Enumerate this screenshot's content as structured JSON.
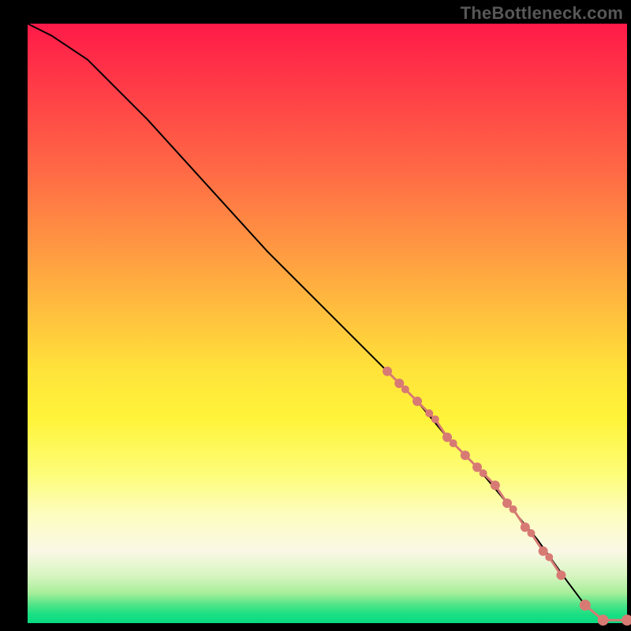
{
  "watermark": "TheBottleneck.com",
  "chart_data": {
    "type": "line",
    "title": "",
    "xlabel": "",
    "ylabel": "",
    "xlim": [
      0,
      100
    ],
    "ylim": [
      0,
      100
    ],
    "grid": false,
    "series": [
      {
        "name": "curve",
        "x": [
          0,
          4,
          10,
          20,
          30,
          40,
          50,
          60,
          65,
          70,
          75,
          80,
          85,
          90,
          93,
          96,
          100
        ],
        "y": [
          100,
          98,
          94,
          84,
          73,
          62,
          52,
          42,
          37,
          31,
          26,
          20,
          14,
          7,
          3,
          0.5,
          0.5
        ]
      }
    ],
    "markers": {
      "name": "beads",
      "x": [
        60,
        62,
        63,
        65,
        67,
        68,
        70,
        71,
        73,
        75,
        76,
        78,
        80,
        81,
        83,
        84,
        86,
        87,
        89,
        93,
        96,
        100
      ],
      "y": [
        42,
        40,
        39,
        37,
        35,
        34,
        31,
        30,
        28,
        26,
        25,
        23,
        20,
        19,
        16,
        15,
        12,
        11,
        8,
        3,
        0.5,
        0.5
      ],
      "radius": [
        6,
        6,
        5,
        6,
        5,
        5,
        6,
        5,
        6,
        6,
        5,
        6,
        6,
        5,
        6,
        5,
        6,
        5,
        6,
        7,
        7,
        7
      ],
      "color": "#d87a74"
    },
    "gradient_stops": [
      {
        "pos": 0,
        "color": "#ff1a49"
      },
      {
        "pos": 25,
        "color": "#ff6b45"
      },
      {
        "pos": 50,
        "color": "#ffcf3d"
      },
      {
        "pos": 70,
        "color": "#fff43a"
      },
      {
        "pos": 85,
        "color": "#fdfdc0"
      },
      {
        "pos": 95,
        "color": "#a6ee9a"
      },
      {
        "pos": 100,
        "color": "#08db82"
      }
    ]
  }
}
